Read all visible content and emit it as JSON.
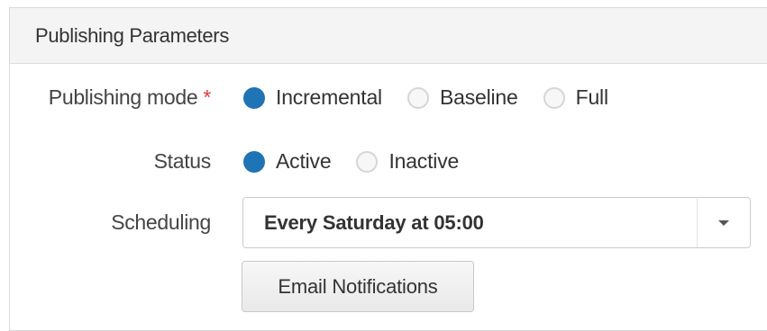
{
  "panel": {
    "title": "Publishing Parameters"
  },
  "form": {
    "publishing_mode": {
      "label": "Publishing mode",
      "required_mark": "*",
      "options": [
        {
          "label": "Incremental",
          "selected": true
        },
        {
          "label": "Baseline",
          "selected": false
        },
        {
          "label": "Full",
          "selected": false
        }
      ]
    },
    "status": {
      "label": "Status",
      "options": [
        {
          "label": "Active",
          "selected": true
        },
        {
          "label": "Inactive",
          "selected": false
        }
      ]
    },
    "scheduling": {
      "label": "Scheduling",
      "value": "Every Saturday at 05:00"
    },
    "email_notifications_label": "Email Notifications"
  },
  "colors": {
    "accent": "#1f74b5",
    "required": "#e0383e",
    "header_bg": "#f4f4f4"
  }
}
